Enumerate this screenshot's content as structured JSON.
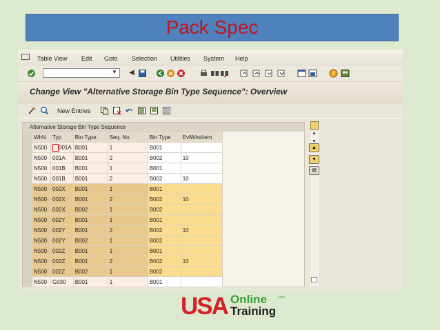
{
  "slide_title": "Pack Spec",
  "menu": {
    "items": [
      "Table View",
      "Edit",
      "Goto",
      "Selection",
      "Utilities",
      "System",
      "Help"
    ]
  },
  "toolbar": {
    "command_field_value": "",
    "icons": [
      "enter-icon",
      "save-icon",
      "back-icon",
      "exit-icon",
      "cancel-icon",
      "print-icon",
      "find-icon",
      "find-next-icon",
      "first-page-icon",
      "prev-page-icon",
      "next-page-icon",
      "last-page-icon",
      "new-session-icon",
      "shortcut-icon",
      "help-icon",
      "layout-icon"
    ]
  },
  "screen_title": "Change View \"Alternative Storage Bin Type Sequence\": Overview",
  "app_toolbar": {
    "new_entries": "New Entries"
  },
  "table": {
    "caption": "Alternative Storage Bin Type Sequence",
    "columns": [
      "WhN",
      "Typ",
      "Bin Type",
      "Seq. No.",
      "Bin Type",
      "EvlWhsItem"
    ],
    "rows": [
      {
        "whn": "N500",
        "typ": "001A",
        "bin1": "B001",
        "seq": "1",
        "bin2": "B001",
        "evl": "",
        "band": "light"
      },
      {
        "whn": "N500",
        "typ": "001A",
        "bin1": "B001",
        "seq": "2",
        "bin2": "B002",
        "evl": "10",
        "band": "light"
      },
      {
        "whn": "N500",
        "typ": "001B",
        "bin1": "B001",
        "seq": "1",
        "bin2": "B001",
        "evl": "",
        "band": "light"
      },
      {
        "whn": "N500",
        "typ": "001B",
        "bin1": "B001",
        "seq": "2",
        "bin2": "B002",
        "evl": "10",
        "band": "light"
      },
      {
        "whn": "N500",
        "typ": "002X",
        "bin1": "B001",
        "seq": "1",
        "bin2": "B001",
        "evl": "",
        "band": "dark"
      },
      {
        "whn": "N500",
        "typ": "002X",
        "bin1": "B001",
        "seq": "2",
        "bin2": "B002",
        "evl": "10",
        "band": "dark"
      },
      {
        "whn": "N500",
        "typ": "002X",
        "bin1": "B002",
        "seq": "1",
        "bin2": "B002",
        "evl": "",
        "band": "dark"
      },
      {
        "whn": "N500",
        "typ": "002Y",
        "bin1": "B001",
        "seq": "1",
        "bin2": "B001",
        "evl": "",
        "band": "dark"
      },
      {
        "whn": "N500",
        "typ": "002Y",
        "bin1": "B001",
        "seq": "2",
        "bin2": "B002",
        "evl": "10",
        "band": "dark"
      },
      {
        "whn": "N500",
        "typ": "002Y",
        "bin1": "B002",
        "seq": "1",
        "bin2": "B002",
        "evl": "",
        "band": "dark"
      },
      {
        "whn": "N500",
        "typ": "002Z",
        "bin1": "B001",
        "seq": "1",
        "bin2": "B001",
        "evl": "",
        "band": "dark"
      },
      {
        "whn": "N500",
        "typ": "002Z",
        "bin1": "B001",
        "seq": "2",
        "bin2": "B002",
        "evl": "10",
        "band": "dark"
      },
      {
        "whn": "N500",
        "typ": "002Z",
        "bin1": "B002",
        "seq": "1",
        "bin2": "B002",
        "evl": "",
        "band": "dark"
      },
      {
        "whn": "N500",
        "typ": "G030",
        "bin1": "B001",
        "seq": "1",
        "bin2": "B001",
        "evl": "",
        "band": "light"
      }
    ]
  },
  "logo": {
    "brand": "USA",
    "line1": "Online",
    "line2": "Training",
    "suffix": ".com"
  },
  "colors": {
    "slide_bg": "#dde9cf",
    "title_bar": "#4f81bd",
    "title_text": "#c0151f",
    "row_dark_key": "#e9c88d",
    "row_dark_data": "#fbdc8e",
    "logo_red": "#d71f26",
    "logo_green": "#3aa13a"
  }
}
